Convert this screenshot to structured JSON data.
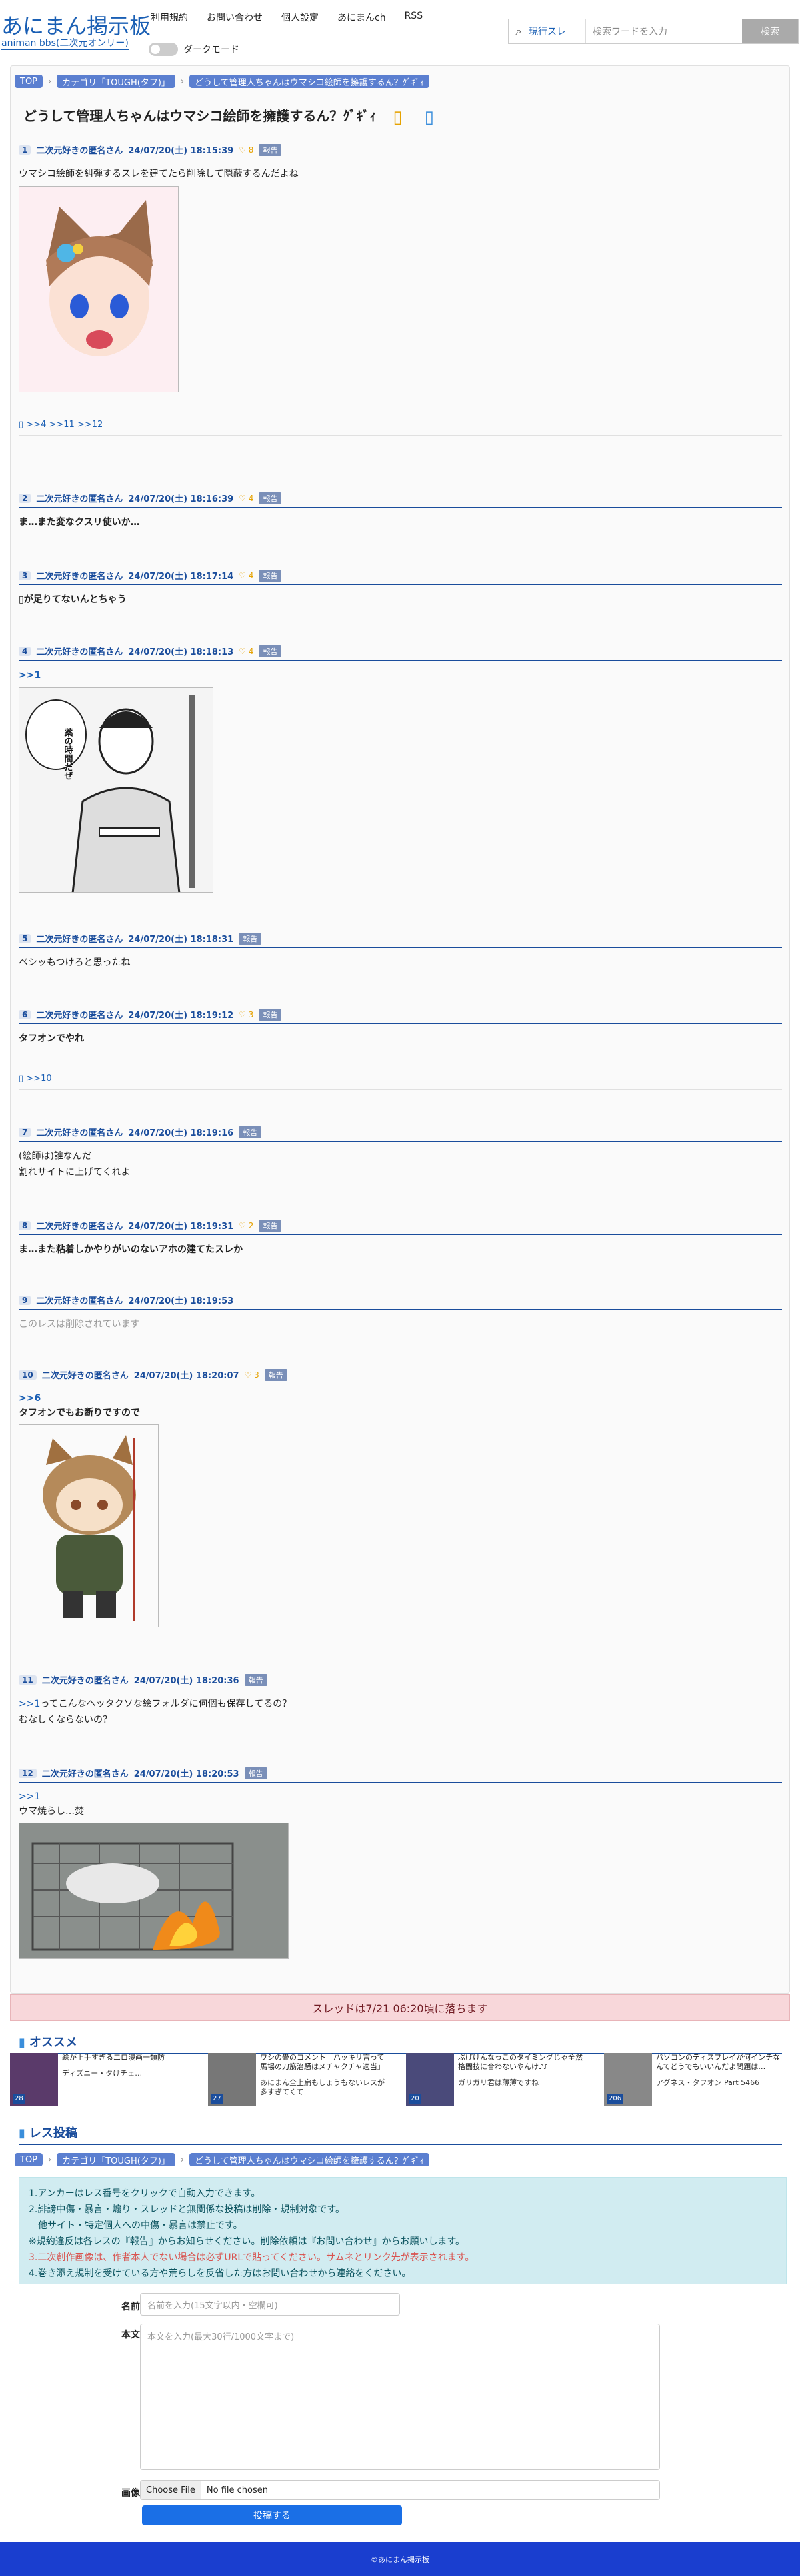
{
  "site": {
    "title": "あにまん掲示板",
    "subtitle": "animan bbs(二次元オンリー)"
  },
  "nav": [
    "利用規約",
    "お問い合わせ",
    "個人設定",
    "あにまんch",
    "RSS"
  ],
  "dark_mode_label": "ダークモード",
  "search": {
    "scope": "現行スレ",
    "placeholder": "検索ワードを入力",
    "button": "検索"
  },
  "breadcrumb": {
    "top": "TOP",
    "category": "カテゴリ「TOUGH(タフ)」",
    "thread": "どうして管理人ちゃんはウマシコ絵師を擁護するん？ｸﾞｷﾞｨ"
  },
  "thread_title": "どうして管理人ちゃんはウマシコ絵師を擁護するん？ｸﾞｷﾞｨ",
  "report_label": "報告",
  "posts": [
    {
      "num": "1",
      "name": "二次元好きの匿名さん",
      "date": "24/07/20(土) 18:15:39",
      "good": "8",
      "text": "ウマシコ絵師を糾弾するスレを建てたら削除して隠蔽するんだよね",
      "replies": ">>4 >>11 >>12"
    },
    {
      "num": "2",
      "name": "二次元好きの匿名さん",
      "date": "24/07/20(土) 18:16:39",
      "good": "4",
      "text": "ま…また変なクスリ使いか…"
    },
    {
      "num": "3",
      "name": "二次元好きの匿名さん",
      "date": "24/07/20(土) 18:17:14",
      "good": "4",
      "text": "が足りてないんとちゃう"
    },
    {
      "num": "4",
      "name": "二次元好きの匿名さん",
      "date": "24/07/20(土) 18:18:13",
      "good": "4",
      "anchor": ">>1",
      "bubble": "薬の時間だぜ"
    },
    {
      "num": "5",
      "name": "二次元好きの匿名さん",
      "date": "24/07/20(土) 18:18:31",
      "good": "",
      "text": "ベシッもつけろと思ったね"
    },
    {
      "num": "6",
      "name": "二次元好きの匿名さん",
      "date": "24/07/20(土) 18:19:12",
      "good": "3",
      "text": "タフオンでやれ",
      "replies": ">>10"
    },
    {
      "num": "7",
      "name": "二次元好きの匿名さん",
      "date": "24/07/20(土) 18:19:16",
      "good": "",
      "text": "(絵師は)誰なんだ",
      "text2": "割れサイトに上げてくれよ"
    },
    {
      "num": "8",
      "name": "二次元好きの匿名さん",
      "date": "24/07/20(土) 18:19:31",
      "good": "2",
      "text": "ま…また粘着しかやりがいのないアホの建てたスレか"
    },
    {
      "num": "9",
      "name": "二次元好きの匿名さん",
      "date": "24/07/20(土) 18:19:53",
      "text": "このレスは削除されています"
    },
    {
      "num": "10",
      "name": "二次元好きの匿名さん",
      "date": "24/07/20(土) 18:20:07",
      "good": "3",
      "anchor": ">>6",
      "text": "タフオンでもお断りですので"
    },
    {
      "num": "11",
      "name": "二次元好きの匿名さん",
      "date": "24/07/20(土) 18:20:36",
      "good": "",
      "anchor": ">>1",
      "text": "ってこんなヘッタクソな絵フォルダに何個も保存してるの？",
      "text2": "むなしくならないの？"
    },
    {
      "num": "12",
      "name": "二次元好きの匿名さん",
      "date": "24/07/20(土) 18:20:53",
      "good": "",
      "anchor": ">>1",
      "text": "ウマ焼らし…焚"
    }
  ],
  "expire_notice": "スレッドは7/21 06:20頃に落ちます",
  "recommend_heading": "オススメ",
  "recommends": [
    {
      "title": "絵が上手すぎるエロ漫画一類防",
      "sub": "ディズニー・タけチェ…",
      "count": "28"
    },
    {
      "title": "ワシの畳のコメント「ハッキリ言って馬場の刀筋治騒はメチャクチャ適当」",
      "sub": "あにまん全上扁もしょうもないレスが多すぎてくて",
      "count": "27"
    },
    {
      "title": "ぶげけんなっこのタイミングじゃ全然格闘技に合わないやんけ♪♪",
      "sub": "ガリガリ君は薄薄ですね",
      "count": "20"
    },
    {
      "title": "パソコンのディスプレイが何インチなんてどうでもいいんだよ問題は…",
      "sub": "アグネス・タフオン Part 5466",
      "count": "206"
    }
  ],
  "post_heading": "レス投稿",
  "rules": [
    "1.アンカーはレス番号をクリックで自動入力できます。",
    "2.誹謗中傷・暴言・煽り・スレッドと無関係な投稿は削除・規制対象です。",
    "　他サイト・特定個人への中傷・暴言は禁止です。",
    "※規約違反は各レスの『報告』からお知らせください。削除依頼は『お問い合わせ』からお願いします。",
    "3.二次創作画像は、作者本人でない場合は必ずURLで貼ってください。サムネとリンク先が表示されます。",
    "4.巻き添え規制を受けている方や荒らしを反省した方はお問い合わせから連絡をください。"
  ],
  "form": {
    "name_label": "名前",
    "name_placeholder": "名前を入力(15文字以内・空欄可)",
    "body_label": "本文",
    "body_placeholder": "本文を入力(最大30行/1000文字まで)",
    "image_label": "画像",
    "file_button": "Choose File",
    "file_status": "No file chosen",
    "submit": "投稿する"
  },
  "footer": "©あにまん掲示板"
}
